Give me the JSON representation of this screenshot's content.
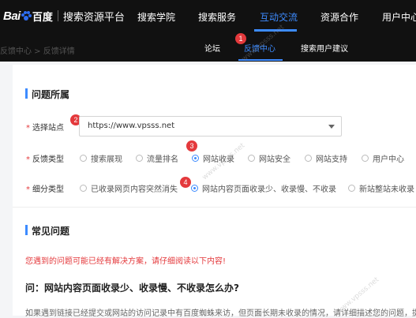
{
  "brand": {
    "logo_bai": "Bai",
    "logo_du": "百度",
    "title": "搜索资源平台"
  },
  "nav": {
    "items": [
      "搜索学院",
      "搜索服务",
      "互动交流",
      "资源合作",
      "用户中心"
    ],
    "active_index": 2
  },
  "subnav": {
    "items": [
      "论坛",
      "反馈中心",
      "搜索用户建议"
    ],
    "active_index": 1
  },
  "breadcrumb": "反馈中心 > 反馈详情",
  "section1": {
    "title": "问题所属"
  },
  "form": {
    "site_label": "选择站点",
    "site_value": "https://www.vpsss.net",
    "feedback_type_label": "反馈类型",
    "feedback_types": [
      "搜索展现",
      "流量排名",
      "网站收录",
      "网站安全",
      "网站支持",
      "用户中心"
    ],
    "feedback_type_selected": 2,
    "sub_type_label": "细分类型",
    "sub_types": [
      "已收录网页内容突然消失",
      "网站内容页面收录少、收录慢、不收录",
      "新站整站未收录"
    ],
    "sub_type_selected": 1,
    "required_mark": "*"
  },
  "badges": [
    "1",
    "2",
    "3",
    "4"
  ],
  "section2": {
    "title": "常见问题"
  },
  "notice": "您遇到的问题可能已经有解决方案，请仔细阅读以下内容!",
  "question": "问：网站内容页面收录少、收录慢、不收录怎么办?",
  "description": "如果遇到链接已经提交或网站的访问记录中有百度蜘蛛来访，但页面长期未收录的情况，请详细描述您的问题，提",
  "watermark": "www.vpsss.net",
  "colors": {
    "accent": "#3d8bff",
    "danger": "#e4393c",
    "topbar": "#111111"
  }
}
